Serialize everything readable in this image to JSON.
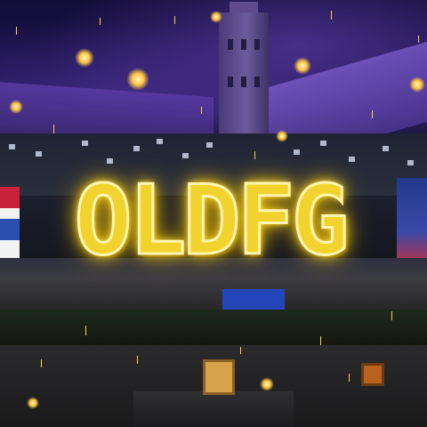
{
  "logo": {
    "text": "OLDFG",
    "color": "#f2d22c",
    "glow": "#ffcc00"
  },
  "scene": {
    "setting": "night",
    "sky_color": "#1d1450",
    "roof_color": "#5a3aa4",
    "flag_colors": [
      "#c8223a",
      "#f2f2f2",
      "#2b4fb0"
    ]
  }
}
